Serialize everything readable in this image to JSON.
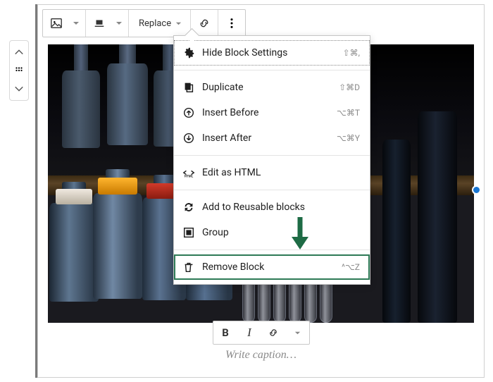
{
  "toolbar": {
    "replace_label": "Replace"
  },
  "menu": {
    "hide_settings": {
      "label": "Hide Block Settings",
      "shortcut": "⇧⌘,"
    },
    "duplicate": {
      "label": "Duplicate",
      "shortcut": "⇧⌘D"
    },
    "insert_before": {
      "label": "Insert Before",
      "shortcut": "⌥⌘T"
    },
    "insert_after": {
      "label": "Insert After",
      "shortcut": "⌥⌘Y"
    },
    "edit_html": {
      "label": "Edit as HTML",
      "shortcut": ""
    },
    "add_reusable": {
      "label": "Add to Reusable blocks",
      "shortcut": ""
    },
    "group": {
      "label": "Group",
      "shortcut": ""
    },
    "remove_block": {
      "label": "Remove Block",
      "shortcut": "^⌥Z"
    }
  },
  "caption": {
    "placeholder": "Write caption…"
  },
  "colors": {
    "accent_arrow": "#1e6b45"
  }
}
